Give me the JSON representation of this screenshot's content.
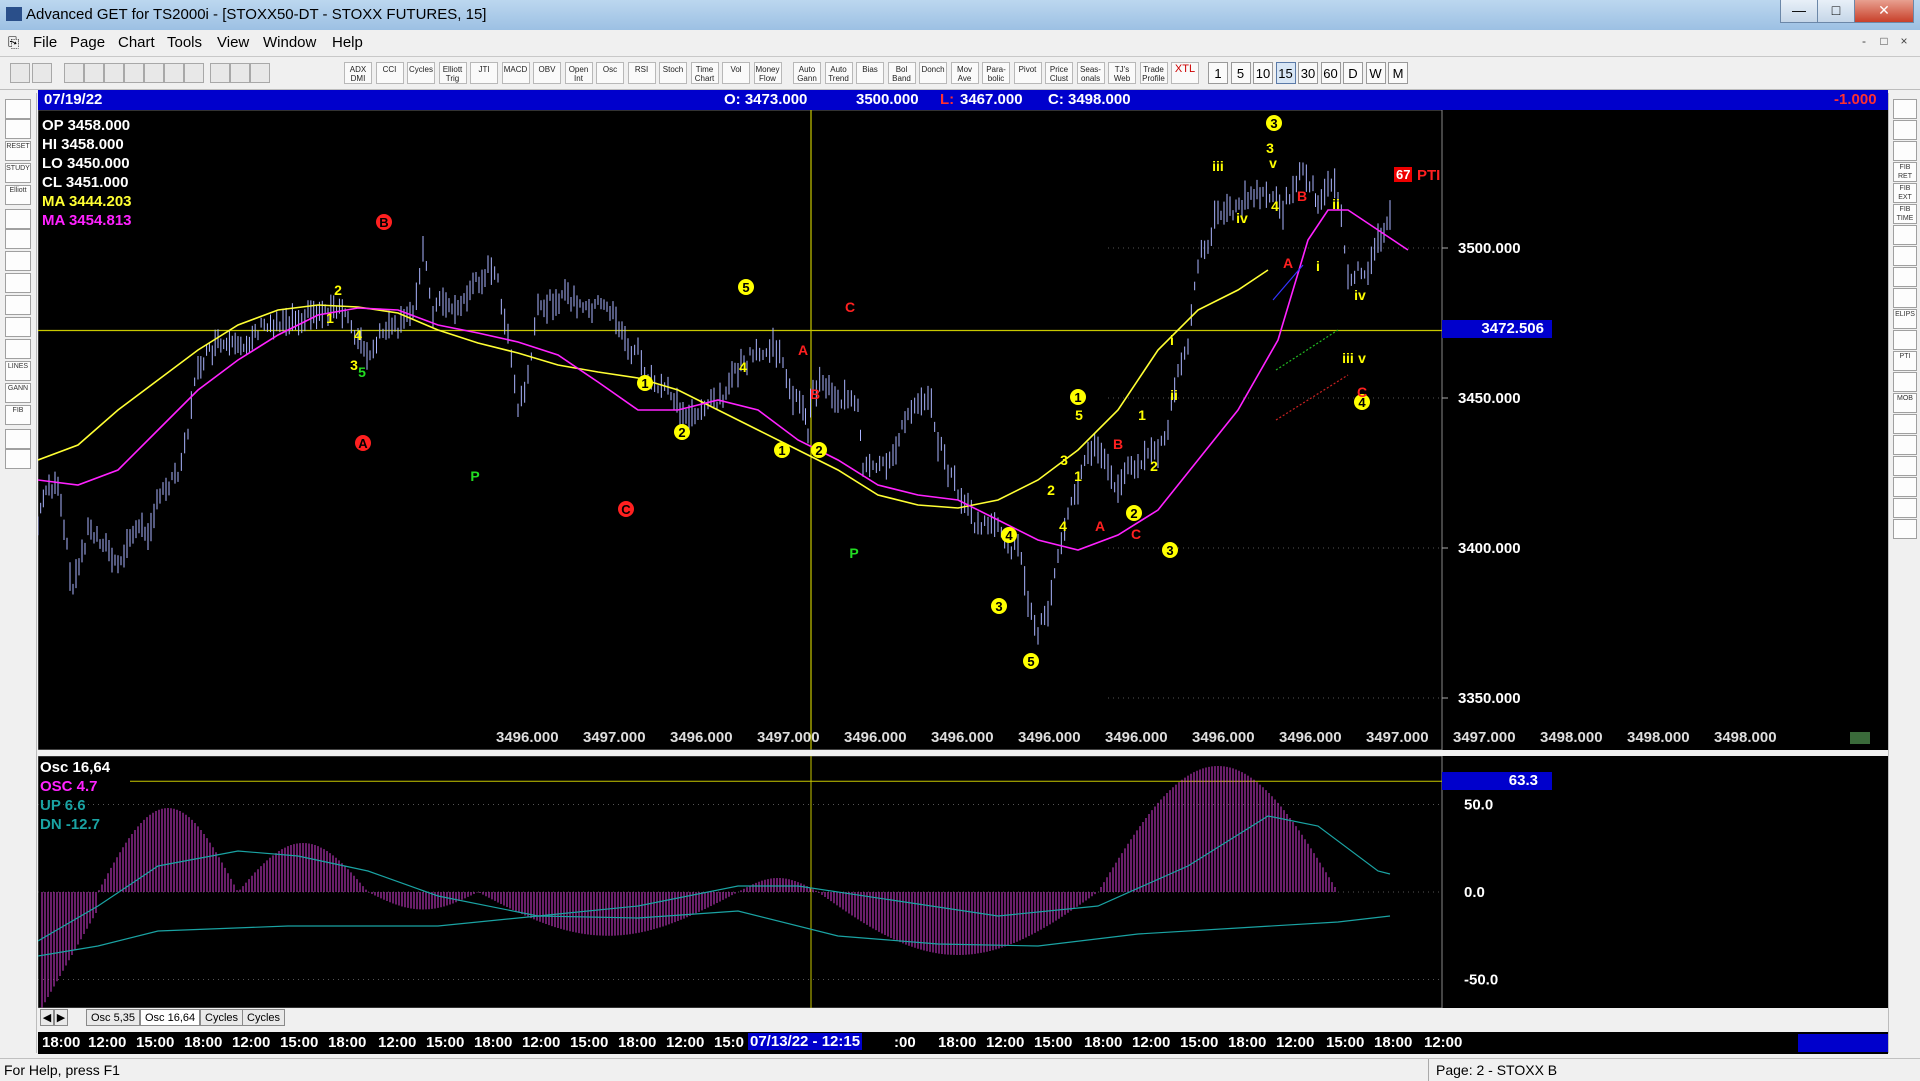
{
  "window": {
    "title": "Advanced GET for TS2000i - [STOXX50-DT - STOXX FUTURES, 15]",
    "min_label": "—",
    "max_label": "□",
    "close_label": "✕"
  },
  "menu": {
    "items": [
      "File",
      "Page",
      "Chart",
      "Tools",
      "View",
      "Window",
      "Help"
    ],
    "mdi_min": "-",
    "mdi_restore": "□",
    "mdi_close": "×"
  },
  "toolbar": {
    "indicators": [
      "ADX DMI",
      "CCI",
      "Cycles",
      "Elliott Trig",
      "JTI",
      "MACD",
      "OBV",
      "Open Int",
      "Osc",
      "RSI",
      "Stoch",
      "Time Chart",
      "Vol",
      "Money Flow",
      "Auto Gann",
      "Auto Trend",
      "Bias",
      "Bol Band",
      "Donch",
      "Mov Ave",
      "Para- bolic",
      "Pivot",
      "Price Clust",
      "Seas- onals",
      "TJ's Web",
      "Trade Profile",
      "XTL"
    ],
    "timeframes": [
      "1",
      "5",
      "10",
      "15",
      "30",
      "60",
      "D",
      "W",
      "M"
    ],
    "active_timeframe": "15"
  },
  "left_tools": [
    "",
    "",
    "RESET",
    "STUDY",
    "Elliott",
    "",
    "",
    "",
    "",
    "",
    "",
    "",
    "LINES",
    "GANN",
    "FIB",
    "",
    ""
  ],
  "right_tools": [
    "",
    "",
    "",
    "FIB RET",
    "FIB EXT",
    "FIB TIME",
    "",
    "",
    "",
    "",
    "ELIPS",
    "",
    "PTI",
    "",
    "MOB",
    "",
    "",
    "",
    "",
    "",
    ""
  ],
  "date_bar": {
    "date": "07/19/22",
    "open": "O: 3473.000",
    "high": "3500.000",
    "low_label": "L:",
    "low": "3467.000",
    "close": "C: 3498.000",
    "change": "-1.000"
  },
  "price_readout": {
    "op": "OP  3458.000",
    "hi": "HI   3458.000",
    "lo": "LO   3450.000",
    "cl": "CL   3451.000",
    "ma1": "MA  3444.203",
    "ma2": "MA  3454.813"
  },
  "price_axis": [
    "3500.000",
    "3450.000",
    "3400.000",
    "3350.000"
  ],
  "current_price": "3472.506",
  "pti": {
    "value": "67",
    "label": "PTI"
  },
  "bottom_values": [
    "3496.000",
    "3497.000",
    "3496.000",
    "3497.000",
    "3496.000",
    "3496.000",
    "3496.000",
    "3496.000",
    "3496.000",
    "3496.000",
    "3497.000",
    "3497.000",
    "3498.000",
    "3498.000",
    "3498.000"
  ],
  "wave_labels": [
    {
      "t": "B",
      "c": "red",
      "circle": true
    },
    {
      "t": "A",
      "c": "red",
      "circle": true
    },
    {
      "t": "C",
      "c": "red",
      "circle": true
    },
    {
      "t": "5",
      "c": "yellow",
      "circle": true
    },
    {
      "t": "1",
      "c": "yellow",
      "circle": true
    },
    {
      "t": "2",
      "c": "yellow",
      "circle": true
    },
    {
      "t": "1",
      "c": "yellow",
      "circle": true
    },
    {
      "t": "2",
      "c": "yellow",
      "circle": true
    },
    {
      "t": "4",
      "c": "yellow",
      "circle": true
    },
    {
      "t": "3",
      "c": "yellow",
      "circle": true
    },
    {
      "t": "5",
      "c": "yellow",
      "circle": true
    },
    {
      "t": "1",
      "c": "yellow",
      "circle": true
    },
    {
      "t": "2",
      "c": "yellow",
      "circle": true
    },
    {
      "t": "3",
      "c": "yellow",
      "circle": true
    },
    {
      "t": "4",
      "c": "yellow",
      "circle": true
    },
    {
      "t": "2",
      "c": "yellow",
      "plain": true
    },
    {
      "t": "1",
      "c": "yellow",
      "plain": true
    },
    {
      "t": "4",
      "c": "yellow",
      "plain": true
    },
    {
      "t": "3",
      "c": "yellow",
      "plain": true
    },
    {
      "t": "5",
      "c": "green",
      "plain": true
    },
    {
      "t": "4",
      "c": "yellow",
      "plain": true
    },
    {
      "t": "A",
      "c": "red",
      "plain": true
    },
    {
      "t": "B",
      "c": "red",
      "plain": true
    },
    {
      "t": "C",
      "c": "red",
      "plain": true
    },
    {
      "t": "P",
      "c": "green",
      "plain": true
    },
    {
      "t": "P",
      "c": "green",
      "plain": true
    },
    {
      "t": "1",
      "c": "yellow",
      "plain": true
    },
    {
      "t": "2",
      "c": "yellow",
      "plain": true
    },
    {
      "t": "3",
      "c": "yellow",
      "plain": true
    },
    {
      "t": "4",
      "c": "yellow",
      "plain": true
    },
    {
      "t": "5",
      "c": "yellow",
      "plain": true
    },
    {
      "t": "A",
      "c": "red",
      "plain": true
    },
    {
      "t": "B",
      "c": "red",
      "plain": true
    },
    {
      "t": "C",
      "c": "red",
      "plain": true
    },
    {
      "t": "1",
      "c": "yellow",
      "plain": true
    },
    {
      "t": "2",
      "c": "yellow",
      "plain": true
    },
    {
      "t": "i",
      "c": "yellow",
      "plain": true
    },
    {
      "t": "ii",
      "c": "yellow",
      "plain": true
    },
    {
      "t": "iii",
      "c": "yellow",
      "plain": true
    },
    {
      "t": "iv",
      "c": "yellow",
      "plain": true
    },
    {
      "t": "3",
      "c": "yellow",
      "plain": true
    },
    {
      "t": "4",
      "c": "yellow",
      "plain": true
    },
    {
      "t": "v",
      "c": "yellow",
      "plain": true
    },
    {
      "t": "B",
      "c": "red",
      "plain": true
    },
    {
      "t": "A",
      "c": "red",
      "plain": true
    },
    {
      "t": "ii",
      "c": "yellow",
      "plain": true
    },
    {
      "t": "i",
      "c": "yellow",
      "plain": true
    },
    {
      "t": "iv",
      "c": "yellow",
      "plain": true
    },
    {
      "t": "iii",
      "c": "yellow",
      "plain": true
    },
    {
      "t": "v",
      "c": "yellow",
      "plain": true
    },
    {
      "t": "C",
      "c": "red",
      "plain": true
    }
  ],
  "osc": {
    "title": "Osc 16,64",
    "osc": "OSC 4.7",
    "up": "UP   6.6",
    "dn": "DN  -12.7",
    "axis": [
      "50.0",
      "0.0",
      "-50.0"
    ],
    "current": "63.3"
  },
  "tabs": [
    "Osc 5,35",
    "Osc 16,64",
    "Cycles",
    "Cycles"
  ],
  "active_tab": "Osc 16,64",
  "time_axis": [
    "18:00",
    "12:00",
    "15:00",
    "18:00",
    "12:00",
    "15:00",
    "18:00",
    "12:00",
    "15:00",
    "18:00",
    "12:00",
    "15:00",
    "18:00",
    "12:00",
    "15:0",
    ":00",
    "18:00",
    "12:00",
    "15:00",
    "18:00",
    "12:00",
    "15:00",
    "18:00",
    "12:00",
    "15:00",
    "18:00",
    "12:00"
  ],
  "time_cursor": "07/13/22 - 12:15",
  "status": {
    "left": "For Help, press F1",
    "right": "Page: 2 - STOXX B"
  },
  "colors": {
    "ma_yellow": "#ffff33",
    "ma_magenta": "#ff22ff",
    "bars": "#aab4ff",
    "wave_yellow": "#ffff00",
    "wave_red": "#ff2020",
    "wave_green": "#22dd22",
    "cursor_line": "#c8c800",
    "blue_bar": "#0000cc"
  },
  "chart_data": {
    "type": "line",
    "price_axis_ticks": [
      3350,
      3400,
      3450,
      3500
    ],
    "current_price": 3472.506,
    "osc_axis_ticks": [
      -50,
      0,
      50
    ],
    "osc_current": 63.3,
    "series": []
  }
}
